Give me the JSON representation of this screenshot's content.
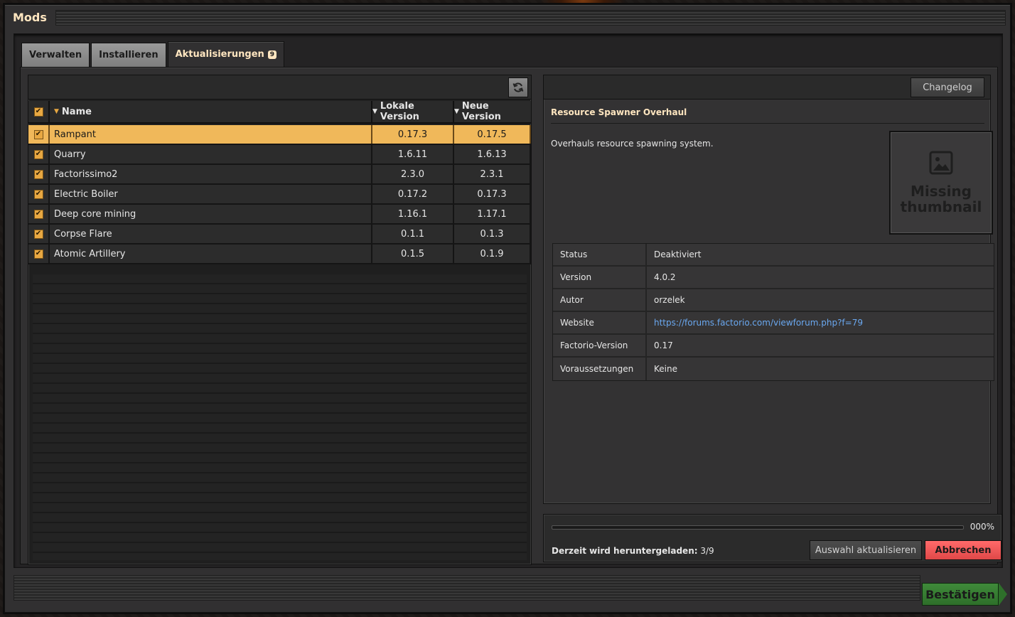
{
  "window": {
    "title": "Mods"
  },
  "tabs": [
    {
      "label": "Verwalten"
    },
    {
      "label": "Installieren"
    },
    {
      "label": "Aktualisierungen",
      "badge": "9"
    }
  ],
  "list": {
    "columns": {
      "name": "Name",
      "local": "Lokale Version",
      "new": "Neue Version"
    },
    "rows": [
      {
        "name": "Rampant",
        "local": "0.17.3",
        "new": "0.17.5",
        "checked": true,
        "selected": true
      },
      {
        "name": "Quarry",
        "local": "1.6.11",
        "new": "1.6.13",
        "checked": true
      },
      {
        "name": "Factorissimo2",
        "local": "2.3.0",
        "new": "2.3.1",
        "checked": true
      },
      {
        "name": "Electric Boiler",
        "local": "0.17.2",
        "new": "0.17.3",
        "checked": true
      },
      {
        "name": "Deep core mining",
        "local": "1.16.1",
        "new": "1.17.1",
        "checked": true
      },
      {
        "name": "Corpse Flare",
        "local": "0.1.1",
        "new": "0.1.3",
        "checked": true
      },
      {
        "name": "Atomic Artillery",
        "local": "0.1.5",
        "new": "0.1.9",
        "checked": true
      }
    ]
  },
  "detail": {
    "changelog_label": "Changelog",
    "title": "Resource Spawner Overhaul",
    "description": "Overhauls resource spawning system.",
    "thumbnail_line1": "Missing",
    "thumbnail_line2": "thumbnail",
    "info": [
      {
        "key": "Status",
        "value": "Deaktiviert"
      },
      {
        "key": "Version",
        "value": "4.0.2"
      },
      {
        "key": "Autor",
        "value": "orzelek"
      },
      {
        "key": "Website",
        "value": "https://forums.factorio.com/viewforum.php?f=79",
        "link": true
      },
      {
        "key": "Factorio-Version",
        "value": "0.17"
      },
      {
        "key": "Voraussetzungen",
        "value": "Keine"
      }
    ]
  },
  "progress": {
    "percent_text": "000%",
    "percent": 0,
    "label": "Derzeit wird heruntergeladen:",
    "count": "3/9",
    "update_label": "Auswahl aktualisieren",
    "cancel_label": "Abbrechen"
  },
  "footer": {
    "confirm_label": "Bestätigen"
  },
  "colors": {
    "accent": "#e8a842",
    "selected_row": "#f0b85a",
    "title_text": "#ffe6c0",
    "link": "#6aa8f0",
    "cancel": "#ff6a6a",
    "confirm": "#3f8a3a"
  }
}
